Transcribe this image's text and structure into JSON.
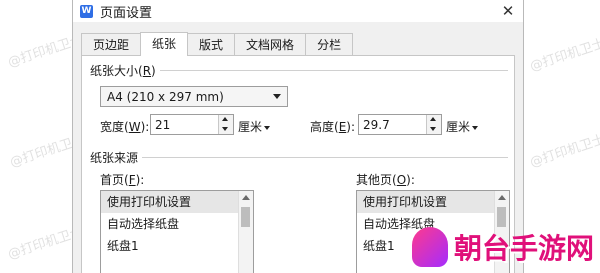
{
  "window": {
    "icon_letter": "W",
    "title": "页面设置",
    "close_symbol": "✕"
  },
  "tabs": [
    {
      "label": "页边距"
    },
    {
      "label": "纸张"
    },
    {
      "label": "版式"
    },
    {
      "label": "文档网格"
    },
    {
      "label": "分栏"
    }
  ],
  "paper_size": {
    "group_label": "纸张大小",
    "group_shortcut": "R",
    "selected": "A4 (210 x 297 mm)",
    "width_label": "宽度",
    "width_shortcut": "W",
    "width_value": "21",
    "width_unit": "厘米",
    "height_label": "高度",
    "height_shortcut": "E",
    "height_value": "29.7",
    "height_unit": "厘米"
  },
  "paper_source": {
    "group_label": "纸张来源",
    "first_page_label": "首页",
    "first_page_shortcut": "F",
    "other_pages_label": "其他页",
    "other_pages_shortcut": "O",
    "first_page_items": [
      "使用打印机设置",
      "自动选择纸盘",
      "纸盘1"
    ],
    "other_page_items": [
      "使用打印机设置",
      "自动选择纸盘",
      "纸盘1"
    ]
  },
  "watermark_text": "@打印机卫士",
  "branding": {
    "logo_text": "朝台手游网"
  }
}
